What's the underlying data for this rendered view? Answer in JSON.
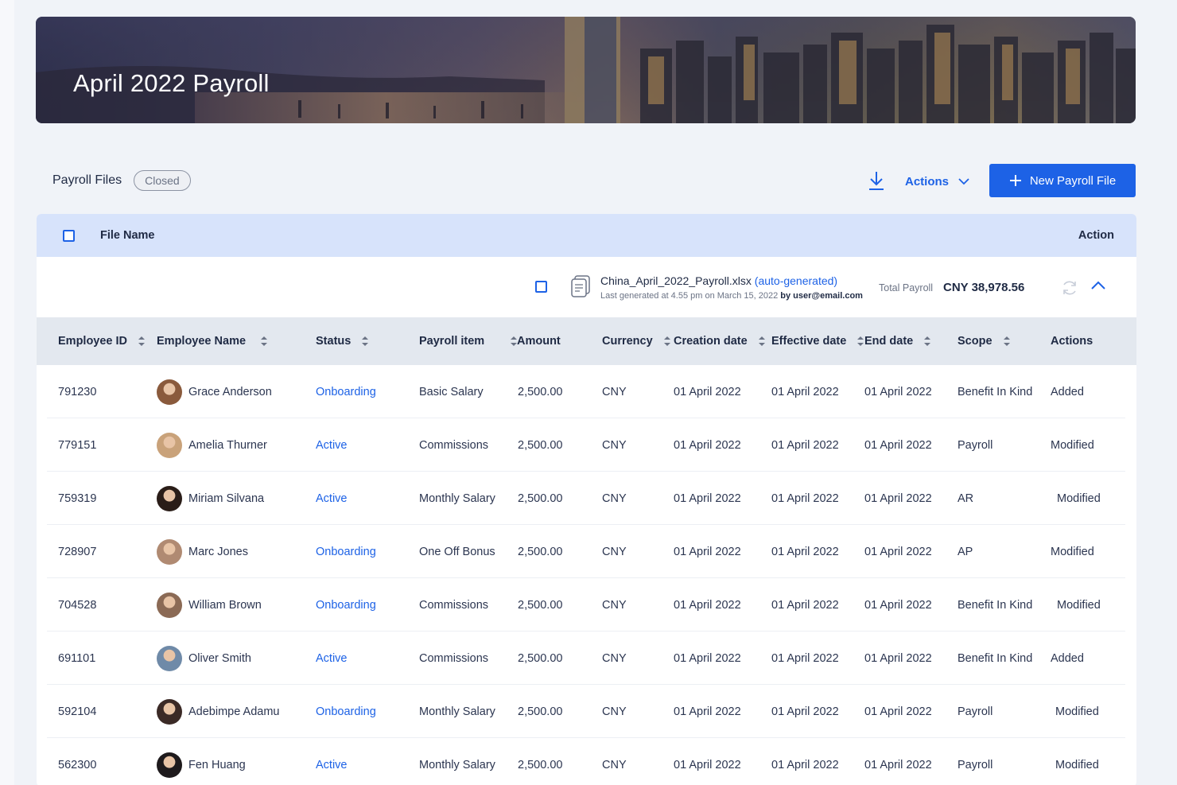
{
  "banner": {
    "title": "April 2022 Payroll"
  },
  "toolbar": {
    "files_label": "Payroll Files",
    "status": "Closed",
    "actions_label": "Actions",
    "new_button_label": "New Payroll File"
  },
  "table_header": {
    "file_name": "File Name",
    "action": "Action"
  },
  "file": {
    "name": "China_April_2022_Payroll.xlsx",
    "tag": "(auto-generated)",
    "meta_prefix": "Last generated at 4.55 pm on March 15, 2022",
    "meta_by": "by user@email.com",
    "total_label": "Total Payroll",
    "total_value": "CNY 38,978.56"
  },
  "columns": [
    "Employee ID",
    "Employee Name",
    "Status",
    "Payroll item",
    "Amount",
    "Currency",
    "Creation date",
    "Effective date",
    "End date",
    "Scope",
    "Actions"
  ],
  "rows": [
    {
      "id": "791230",
      "name": "Grace Anderson",
      "status": "Onboarding",
      "item": "Basic Salary",
      "amount": "2,500.00",
      "currency": "CNY",
      "created": "01 April 2022",
      "effective": "01 April 2022",
      "end": "01 April 2022",
      "scope": "Benefit In Kind",
      "action": "Added",
      "avatar_color": "#8a5a3c"
    },
    {
      "id": "779151",
      "name": "Amelia Thurner",
      "status": "Active",
      "item": "Commissions",
      "amount": "2,500.00",
      "currency": "CNY",
      "created": "01 April 2022",
      "effective": "01 April 2022",
      "end": "01 April 2022",
      "scope": "Payroll",
      "action": "Modified",
      "avatar_color": "#c9a27a"
    },
    {
      "id": "759319",
      "name": "Miriam Silvana",
      "status": "Active",
      "item": "Monthly Salary",
      "amount": "2,500.00",
      "currency": "CNY",
      "created": "01 April 2022",
      "effective": "01 April 2022",
      "end": "01 April 2022",
      "scope": "AR",
      "action": "Modified",
      "avatar_color": "#2a1d18"
    },
    {
      "id": "728907",
      "name": "Marc Jones",
      "status": "Onboarding",
      "item": "One Off Bonus",
      "amount": "2,500.00",
      "currency": "CNY",
      "created": "01 April 2022",
      "effective": "01 April 2022",
      "end": "01 April 2022",
      "scope": "AP",
      "action": "Modified",
      "avatar_color": "#b08a72"
    },
    {
      "id": "704528",
      "name": "William Brown",
      "status": "Onboarding",
      "item": "Commissions",
      "amount": "2,500.00",
      "currency": "CNY",
      "created": "01 April 2022",
      "effective": "01 April 2022",
      "end": "01 April 2022",
      "scope": "Benefit In Kind",
      "action": "Modified",
      "avatar_color": "#8b6a55"
    },
    {
      "id": "691101",
      "name": "Oliver Smith",
      "status": "Active",
      "item": "Commissions",
      "amount": "2,500.00",
      "currency": "CNY",
      "created": "01 April 2022",
      "effective": "01 April 2022",
      "end": "01 April 2022",
      "scope": "Benefit In Kind",
      "action": "Added",
      "avatar_color": "#6f8aa8"
    },
    {
      "id": "592104",
      "name": "Adebimpe Adamu",
      "status": "Onboarding",
      "item": "Monthly Salary",
      "amount": "2,500.00",
      "currency": "CNY",
      "created": "01 April 2022",
      "effective": "01 April 2022",
      "end": "01 April 2022",
      "scope": "Payroll",
      "action": "Modified",
      "avatar_color": "#3b2a26"
    },
    {
      "id": "562300",
      "name": "Fen Huang",
      "status": "Active",
      "item": "Monthly Salary",
      "amount": "2,500.00",
      "currency": "CNY",
      "created": "01 April 2022",
      "effective": "01 April 2022",
      "end": "01 April 2022",
      "scope": "Payroll",
      "action": "Modified",
      "avatar_color": "#1e1a1c"
    }
  ],
  "colors": {
    "accent": "#1d62e6",
    "header_bg": "#d7e3fb",
    "col_header_bg": "#e3e8ef"
  }
}
